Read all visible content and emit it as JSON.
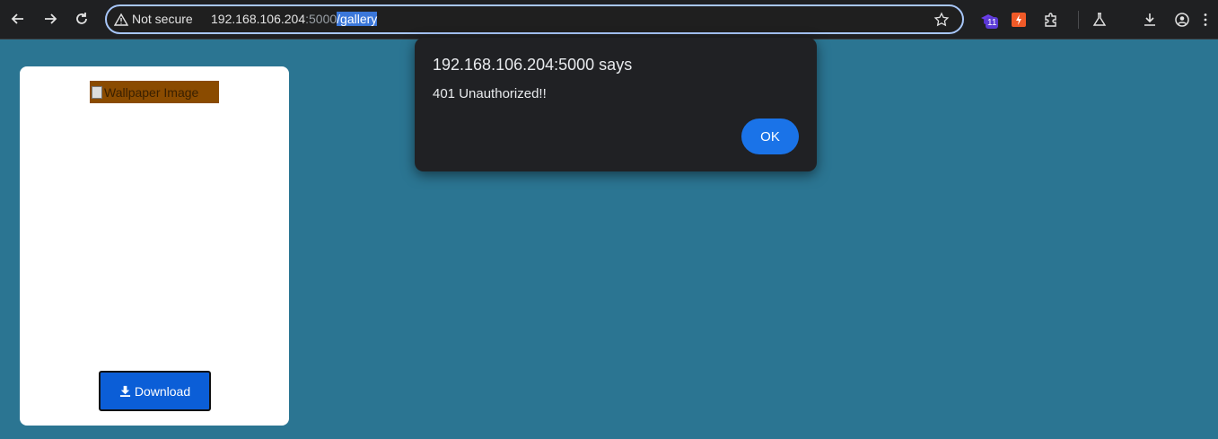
{
  "browser": {
    "security_label": "Not secure",
    "url_host": "192.168.106.204",
    "url_port": ":5000",
    "url_path": "/gallery",
    "extension_badge": "11"
  },
  "page": {
    "card": {
      "image_alt": "Wallpaper Image",
      "download_label": "Download"
    }
  },
  "dialog": {
    "title": "192.168.106.204:5000 says",
    "message": "401 Unauthorized!!",
    "ok_label": "OK"
  },
  "colors": {
    "page_background": "#2b7592",
    "dialog_background": "#202124",
    "ok_button": "#1a73e8",
    "download_button": "#0b5ed7"
  },
  "icons": [
    "back-icon",
    "forward-icon",
    "reload-icon",
    "warning-icon",
    "star-icon",
    "extension-icon",
    "bolt-icon",
    "puzzle-icon",
    "flask-icon",
    "download-icon",
    "account-icon",
    "menu-icon"
  ]
}
